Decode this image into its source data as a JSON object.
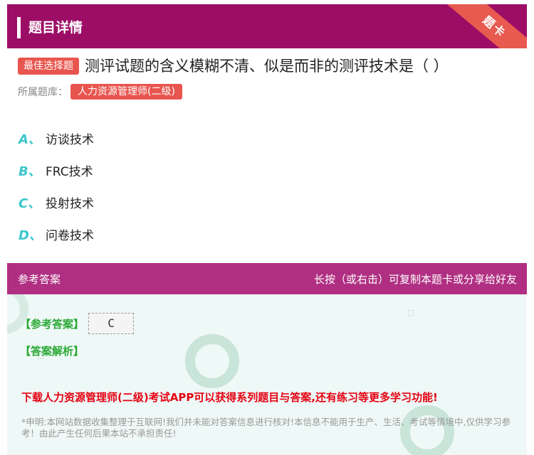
{
  "header": {
    "title": "题目详情",
    "ribbon_label": "题卡"
  },
  "question": {
    "type_badge": "最佳选择题",
    "text": "测评试题的含义模糊不清、似是而非的测评技术是（ ）",
    "bank_label": "所属题库：",
    "bank_name": "人力资源管理师(二级)"
  },
  "options": [
    {
      "letter": "A、",
      "text": "访谈技术"
    },
    {
      "letter": "B、",
      "text": "FRC技术"
    },
    {
      "letter": "C、",
      "text": "投射技术"
    },
    {
      "letter": "D、",
      "text": "问卷技术"
    }
  ],
  "answer": {
    "header_left": "参考答案",
    "header_right": "长按（或右击）可复制本题卡或分享给好友",
    "ref_label": "【参考答案】",
    "ref_value": "C",
    "analysis_label": "【答案解析】",
    "download_text": "下载人力资源管理师(二级)考试APP可以获得系列题目与答案,还有练习等更多学习功能!",
    "disclaimer": "*申明:本网站数据收集整理于互联网!我们并未能对答案信息进行核对!本信息不能用于生产、生活、考试等情境中,仅供学习参考！由此产生任何后果本站不承担责任!"
  },
  "colors": {
    "header_bg": "#9c0d66",
    "answer_header_bg": "#b02f82",
    "badge_bg": "#e8554e",
    "option_letter": "#3cc6cc",
    "answer_label": "#2aa835",
    "download_text": "#e60012"
  }
}
